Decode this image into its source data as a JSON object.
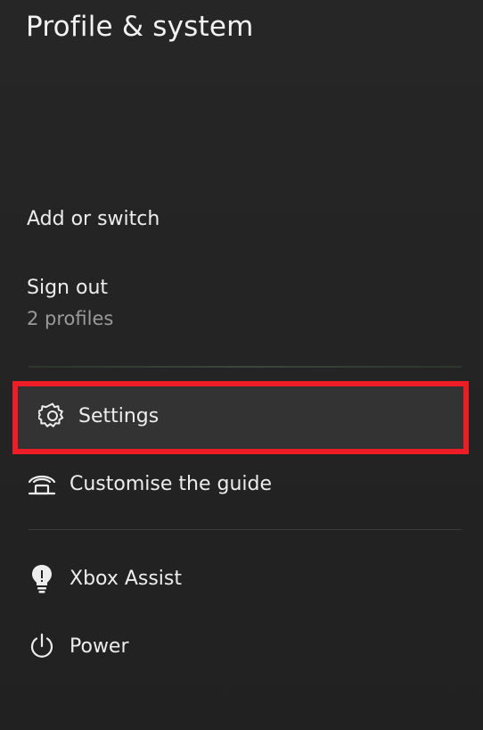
{
  "header": {
    "title": "Profile & system"
  },
  "profile": {
    "add_switch_label": "Add or switch",
    "sign_out_label": "Sign out",
    "sign_out_sub": "2 profiles"
  },
  "menu": {
    "settings_label": "Settings",
    "guide_label": "Customise the guide",
    "assist_label": "Xbox Assist",
    "power_label": "Power"
  },
  "icons": {
    "settings": "gear-icon",
    "guide": "guide-icon",
    "assist": "lightbulb-icon",
    "power": "power-icon"
  },
  "colors": {
    "background": "#222222",
    "highlight_border": "#ee1c25",
    "selected_row": "#333333",
    "text": "#ededed",
    "subtext": "#9a9a9a"
  }
}
